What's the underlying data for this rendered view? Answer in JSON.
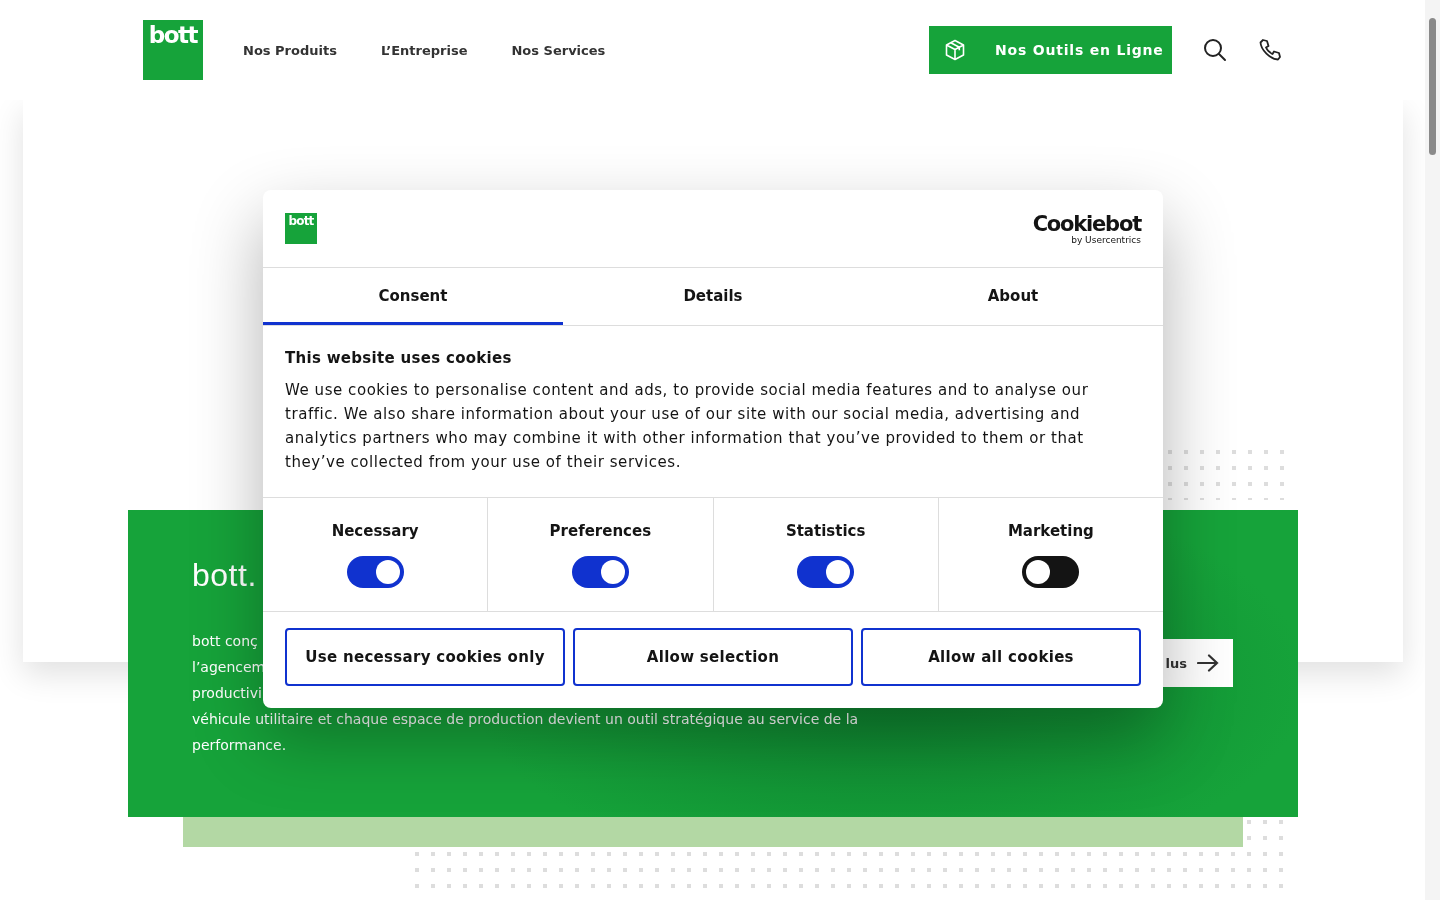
{
  "header": {
    "logo": "bott",
    "nav": [
      {
        "label": "Nos Produits"
      },
      {
        "label": "L’Entreprise"
      },
      {
        "label": "Nos Services"
      }
    ],
    "cta": "Nos Outils en Ligne"
  },
  "hero": {
    "heading": "bott.",
    "paragraph_lines": [
      "bott conç",
      "l’agencem",
      "productivi",
      "véhicule utilitaire et chaque espace de production devient un outil stratégique au service de la",
      "performance."
    ],
    "more_button": "lus"
  },
  "cookie_dialog": {
    "logo": "bott",
    "brand": "Cookiebot",
    "brand_sub": "by Usercentrics",
    "tabs": [
      {
        "label": "Consent",
        "selected": true
      },
      {
        "label": "Details",
        "selected": false
      },
      {
        "label": "About",
        "selected": false
      }
    ],
    "title": "This website uses cookies",
    "text": "We use cookies to personalise content and ads, to provide social media features and to analyse our traffic. We also share information about your use of our site with our social media, advertising and analytics partners who may combine it with other information that you’ve provided to them or that they’ve collected from your use of their services.",
    "toggles": [
      {
        "label": "Necessary",
        "on": true
      },
      {
        "label": "Preferences",
        "on": true
      },
      {
        "label": "Statistics",
        "on": true
      },
      {
        "label": "Marketing",
        "on": false
      }
    ],
    "buttons": [
      "Use necessary cookies only",
      "Allow selection",
      "Allow all cookies"
    ]
  }
}
